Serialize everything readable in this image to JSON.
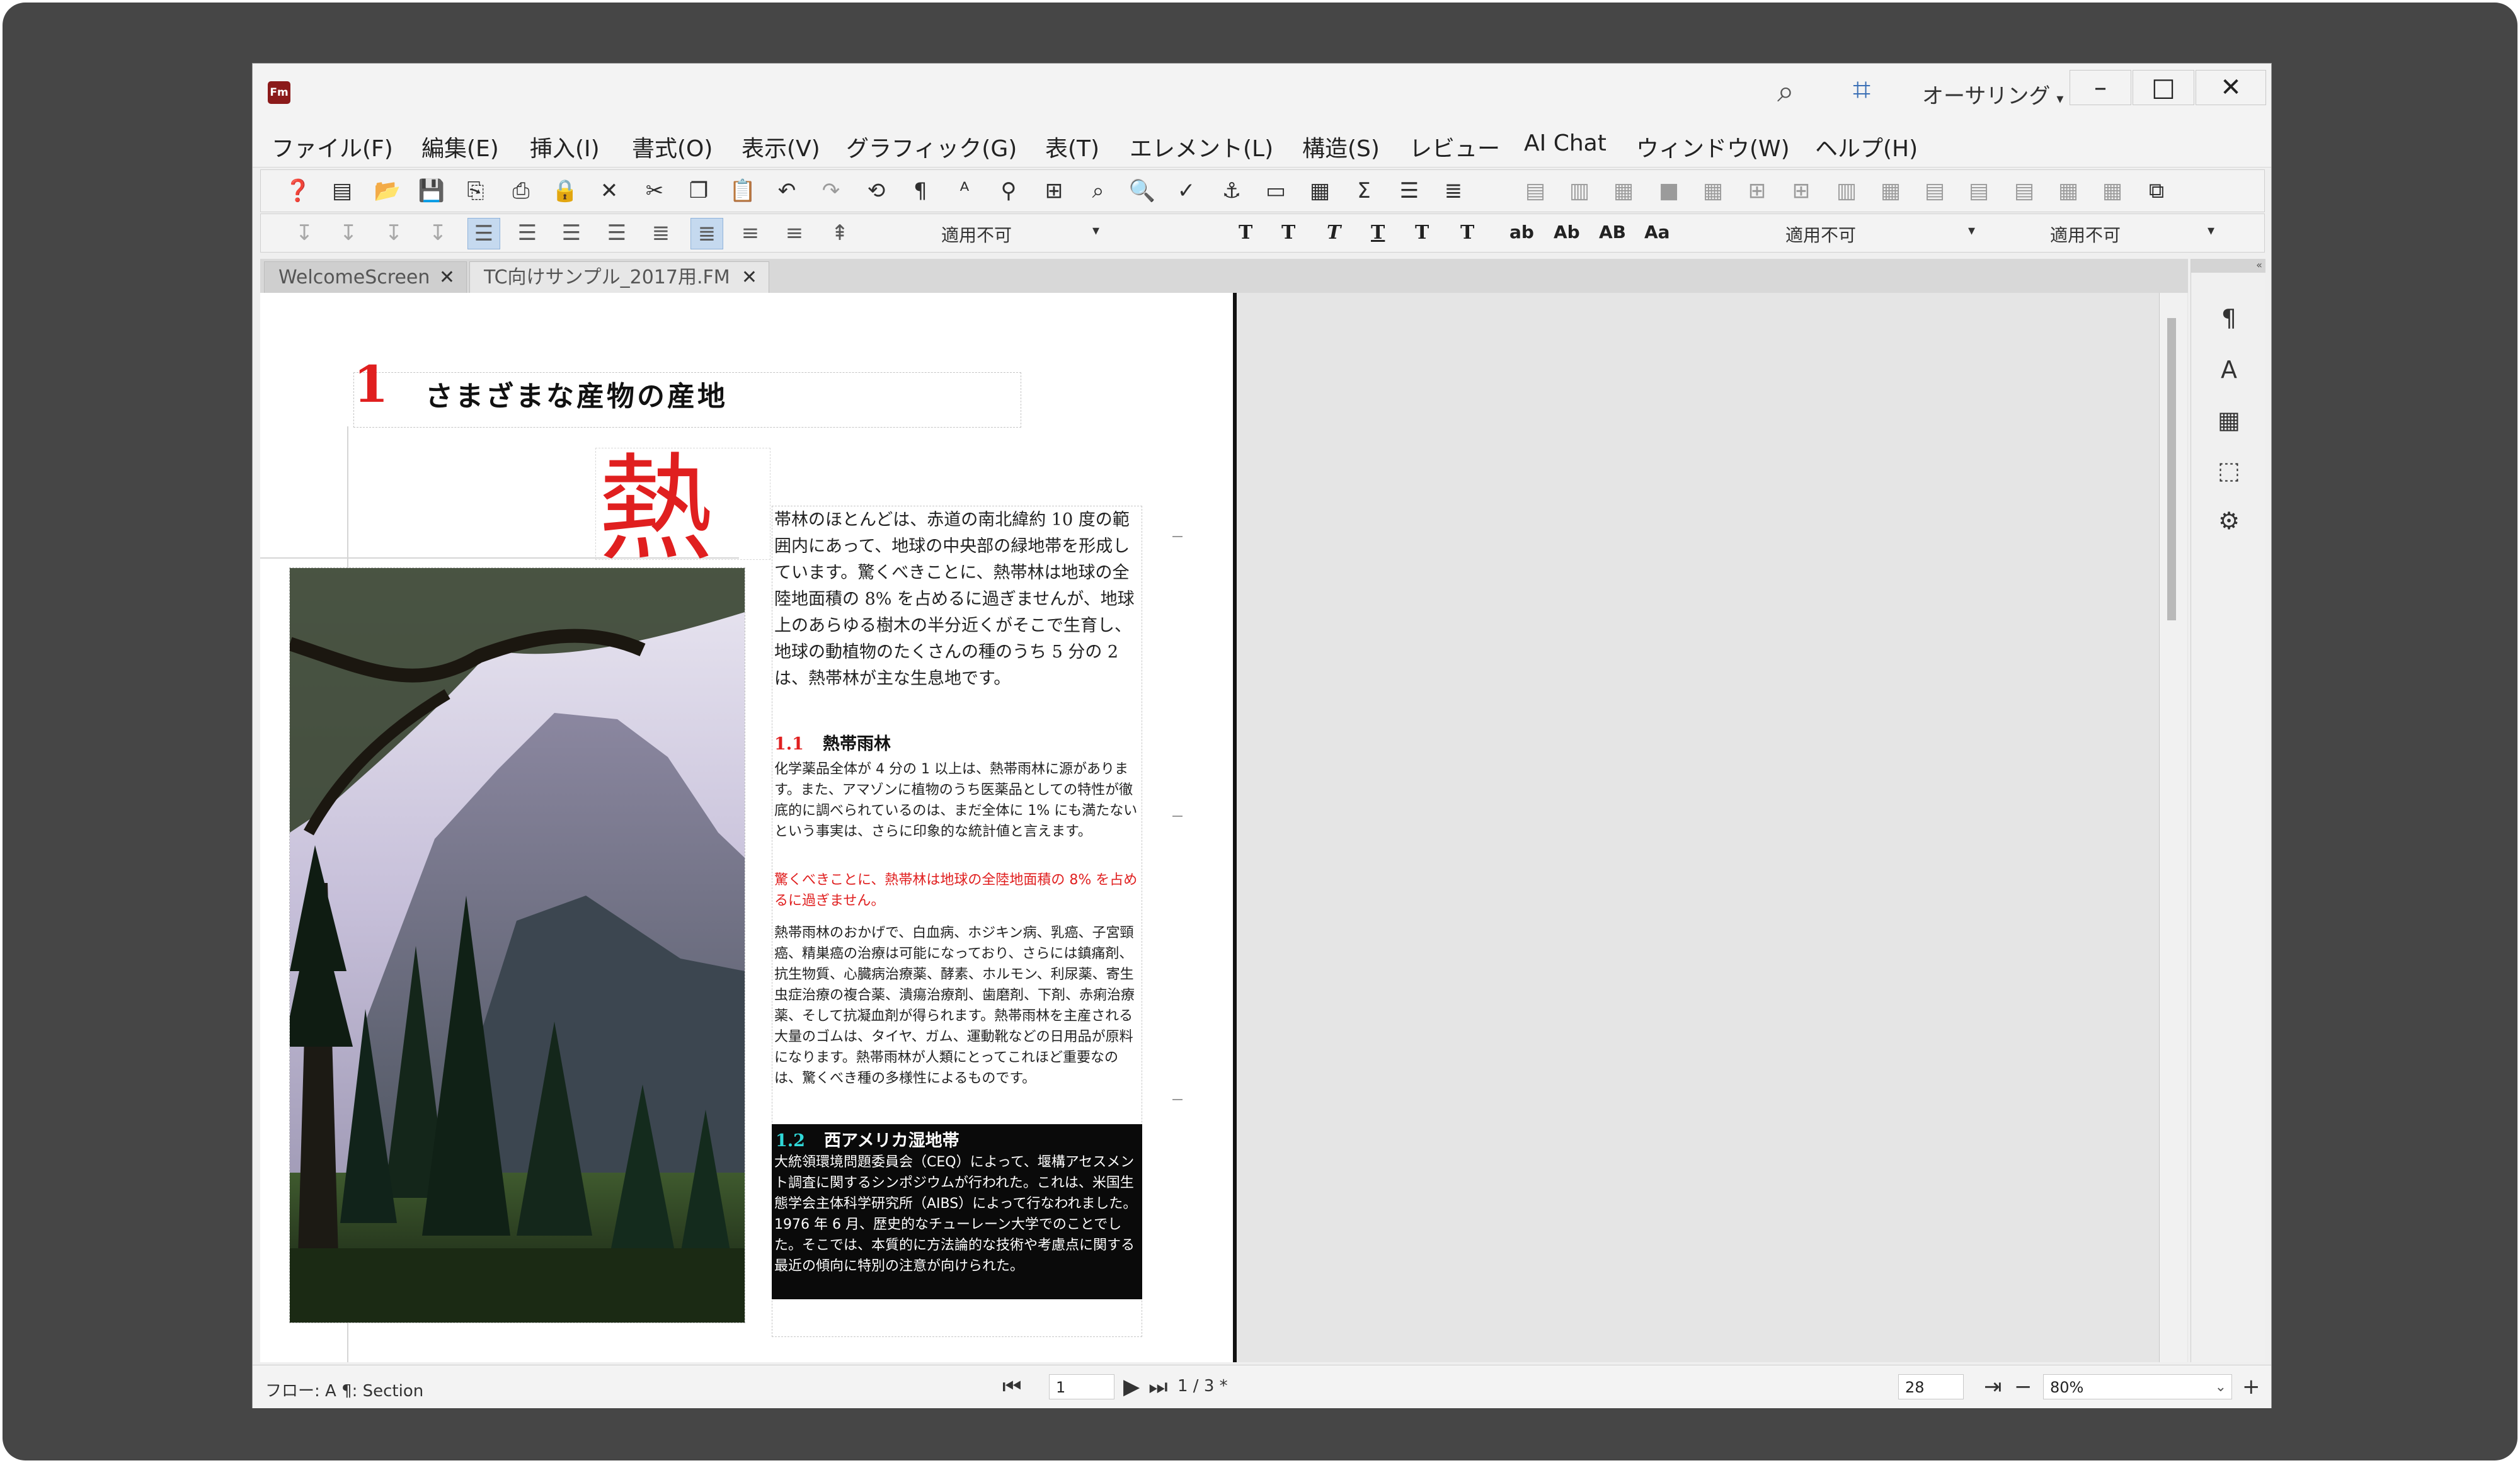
{
  "window": {
    "app_icon": "Fm",
    "authoring_label": "オーサリング",
    "search_icon": "search-icon",
    "crop_icon": "crop-icon"
  },
  "menu": [
    "ファイル(F)",
    "編集(E)",
    "挿入(I)",
    "書式(O)",
    "表示(V)",
    "グラフィック(G)",
    "表(T)",
    "エレメント(L)",
    "構造(S)",
    "レビュー",
    "AI Chat",
    "ウィンドウ(W)",
    "ヘルプ(H)"
  ],
  "toolbar2": {
    "paragraph_style": "適用不可",
    "text_buttons": [
      "T",
      "T",
      "T",
      "T",
      "T",
      "T",
      "ab",
      "Ab",
      "AB",
      "Aa"
    ],
    "char_style": "適用不可",
    "font_style": "適用不可"
  },
  "tabs": [
    {
      "label": "WelcomeScreen"
    },
    {
      "label": "TC向けサンプル_2017用.FM"
    }
  ],
  "document": {
    "heading_number": "1",
    "heading_title": "さまざまな産物の産地",
    "drop_cap": "熱",
    "para_main": "帯林のほとんどは、赤道の南北緯約 10 度の範囲内にあって、地球の中央部の緑地帯を形成しています。驚くべきことに、熱帯林は地球の全陸地面積の 8% を占めるに過ぎませんが、地球上のあらゆる樹木の半分近くがそこで生育し、地球の動植物のたくさんの種のうち 5 分の 2 は、熱帯林が主な生息地です。",
    "section1_number": "1.1",
    "section1_title": "熱帯雨林",
    "para_small_1": "化学薬品全体が 4 分の 1 以上は、熱帯雨林に源があります。また、アマゾンに植物のうち医薬品としての特性が徹底的に調べられているのは、まだ全体に 1% にも満たないという事実は、さらに印象的な統計値と言えます。",
    "para_red": "驚くべきことに、熱帯林は地球の全陸地面積の 8% を占めるに過ぎません。",
    "para_small_2": "熱帯雨林のおかげで、白血病、ホジキン病、乳癌、子宮頸癌、精巣癌の治療は可能になっており、さらには鎮痛剤、抗生物質、心臓病治療薬、酵素、ホルモン、利尿薬、寄生虫症治療の複合薬、潰瘍治療剤、歯磨剤、下剤、赤痢治療薬、そして抗凝血剤が得られます。熱帯雨林を主産される大量のゴムは、タイヤ、ガム、運動靴などの日用品が原料になります。熱帯雨林が人類にとってこれほど重要なのは、驚くべき種の多様性によるものです。",
    "section2_number": "1.2",
    "section2_title": "西アメリカ湿地帯",
    "para_inv": "大統領環境問題委員会（CEQ）によって、堰構アセスメント調査に関するシンポジウムが行われた。これは、米国生態学会主体科学研究所（AIBS）によって行なわれました。1976 年 6 月、歴史的なチューレーン大学でのことでした。そこでは、本質的に方法論的な技術や考慮点に関する最近の傾向に特別の注意が向けられた。"
  },
  "status": {
    "flow": "フロー: A ¶: Section",
    "page_input": "1",
    "page_count": "1 / 3 *",
    "field_value": "28",
    "zoom": "80%"
  },
  "colors": {
    "frame": "#464646",
    "accent_red": "#e01f1f",
    "selection": "#c5d9ef"
  }
}
